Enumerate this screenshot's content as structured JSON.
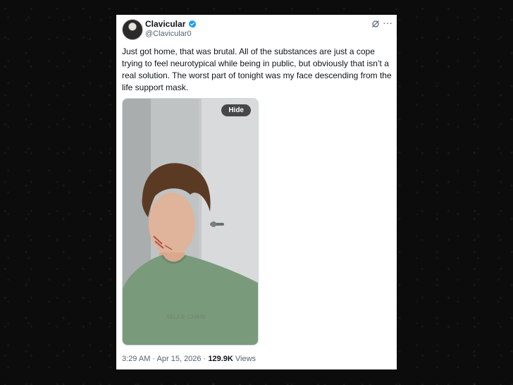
{
  "tweet": {
    "display_name": "Clavicular",
    "handle": "@Clavicular0",
    "text": "Just got home, that was brutal. All of the substances are just a cope trying to feel neurotypical while being in public, but obviously that isn’t a real solution. The worst part of tonight was my face descending from the life support mask.",
    "media": {
      "hide_label": "Hide",
      "alt": "Selfie of a young man with curly brown hair and scratches on his face, wearing a green t-shirt, standing by a white door"
    },
    "time": "3:29 AM",
    "separator": "·",
    "date": "Apr 15, 2026",
    "views_count": "129.9K",
    "views_label": "Views"
  },
  "colors": {
    "verified": "#1d9bf0",
    "text": "#0f1419",
    "muted": "#536471"
  },
  "icons": [
    "verified-badge-icon",
    "grok-icon",
    "more-icon"
  ]
}
